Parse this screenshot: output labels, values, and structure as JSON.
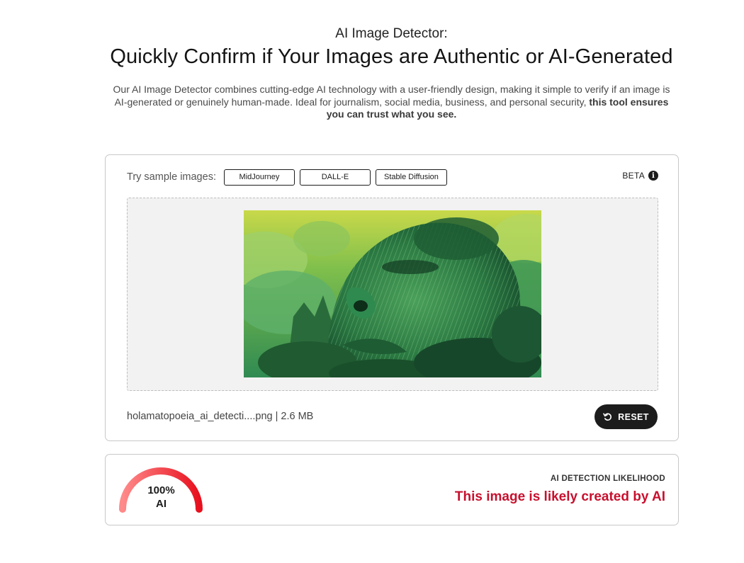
{
  "header": {
    "eyebrow": "AI Image Detector:",
    "title": "Quickly Confirm if Your Images are Authentic or AI-Generated",
    "description": "Our AI Image Detector combines cutting-edge AI technology with a user-friendly design, making it simple to verify if an image is AI-generated or genuinely human-made. Ideal for journalism, social media, business, and personal security,",
    "description_bold": "this tool ensures you can trust what you see."
  },
  "upload": {
    "samples_label": "Try sample images:",
    "samples": [
      "MidJourney",
      "DALL-E",
      "Stable Diffusion"
    ],
    "beta_label": "BETA",
    "info_icon": "info-icon",
    "file_info": "holamatopoeia_ai_detecti....png | 2.6 MB",
    "reset_label": "RESET",
    "reset_icon": "rotate-ccw-icon"
  },
  "result": {
    "gauge_value": 1.0,
    "gauge_percent": "100%",
    "gauge_class": "AI",
    "label": "AI DETECTION LIKELIHOOD",
    "verdict": "This image is likely created by AI",
    "colors": {
      "gauge_start": "#ff8a8a",
      "gauge_end": "#e8101e",
      "verdict": "#c8102e"
    }
  }
}
